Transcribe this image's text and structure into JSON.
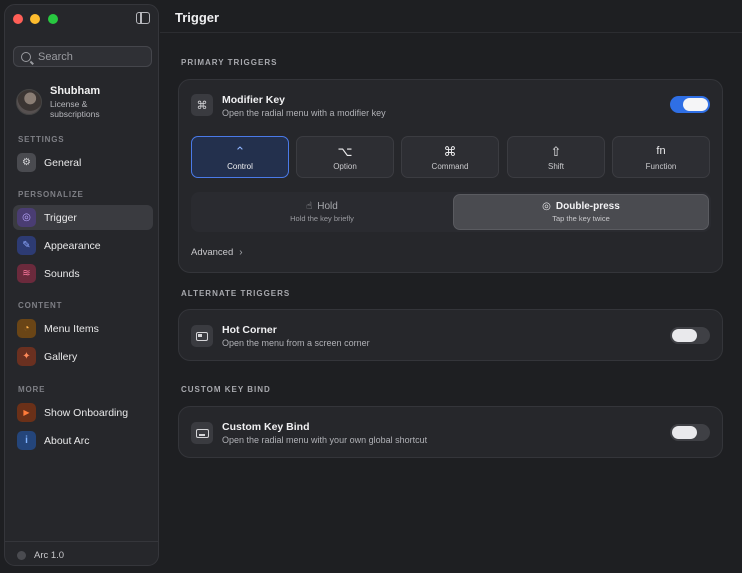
{
  "sidebar": {
    "search_placeholder": "Search",
    "profile": {
      "name": "Shubham",
      "subtitle_line1": "License &",
      "subtitle_line2": "subscriptions"
    },
    "sections": {
      "settings": "SETTINGS",
      "personalize": "PERSONALIZE",
      "content": "CONTENT",
      "more": "MORE"
    },
    "items": [
      {
        "label": "General",
        "icon": "gear-icon",
        "glyph": "⚙"
      },
      {
        "label": "Trigger",
        "icon": "trigger-icon",
        "glyph": "◎",
        "active": true
      },
      {
        "label": "Appearance",
        "icon": "brush-icon",
        "glyph": "✎"
      },
      {
        "label": "Sounds",
        "icon": "waveform-icon",
        "glyph": "≋"
      },
      {
        "label": "Menu Items",
        "icon": "pie-icon",
        "glyph": "◔"
      },
      {
        "label": "Gallery",
        "icon": "sparkle-icon",
        "glyph": "✦"
      },
      {
        "label": "Show Onboarding",
        "icon": "play-icon",
        "glyph": "▶"
      },
      {
        "label": "About Arc",
        "icon": "info-icon",
        "glyph": "i"
      }
    ],
    "footer": "Arc 1.0"
  },
  "page": {
    "title": "Trigger"
  },
  "primary": {
    "heading": "PRIMARY TRIGGERS",
    "modifier": {
      "title": "Modifier Key",
      "subtitle": "Open the radial menu with a modifier key",
      "glyph": "⌘",
      "enabled": true
    },
    "keys": [
      {
        "glyph": "⌃",
        "label": "Control",
        "selected": true
      },
      {
        "glyph": "⌥",
        "label": "Option"
      },
      {
        "glyph": "⌘",
        "label": "Command"
      },
      {
        "glyph": "⇧",
        "label": "Shift"
      },
      {
        "glyph": "fn",
        "label": "Function"
      }
    ],
    "modes": [
      {
        "title": "Hold",
        "subtitle": "Hold the key briefly",
        "glyph": "☝"
      },
      {
        "title": "Double-press",
        "subtitle": "Tap the key twice",
        "glyph": "◎",
        "selected": true
      }
    ],
    "advanced": "Advanced",
    "advanced_chevron": "›"
  },
  "alternate": {
    "heading": "ALTERNATE TRIGGERS",
    "hot_corner": {
      "title": "Hot Corner",
      "subtitle": "Open the menu from a screen corner",
      "enabled": false
    }
  },
  "custom": {
    "heading": "CUSTOM KEY BIND",
    "key_bind": {
      "title": "Custom Key Bind",
      "subtitle": "Open the radial menu with your own global shortcut",
      "enabled": false
    }
  },
  "colors": {
    "accent": "#2f6fe5",
    "selected_border": "#4a7ae8",
    "background": "#1e1f22",
    "card": "#26272b"
  }
}
